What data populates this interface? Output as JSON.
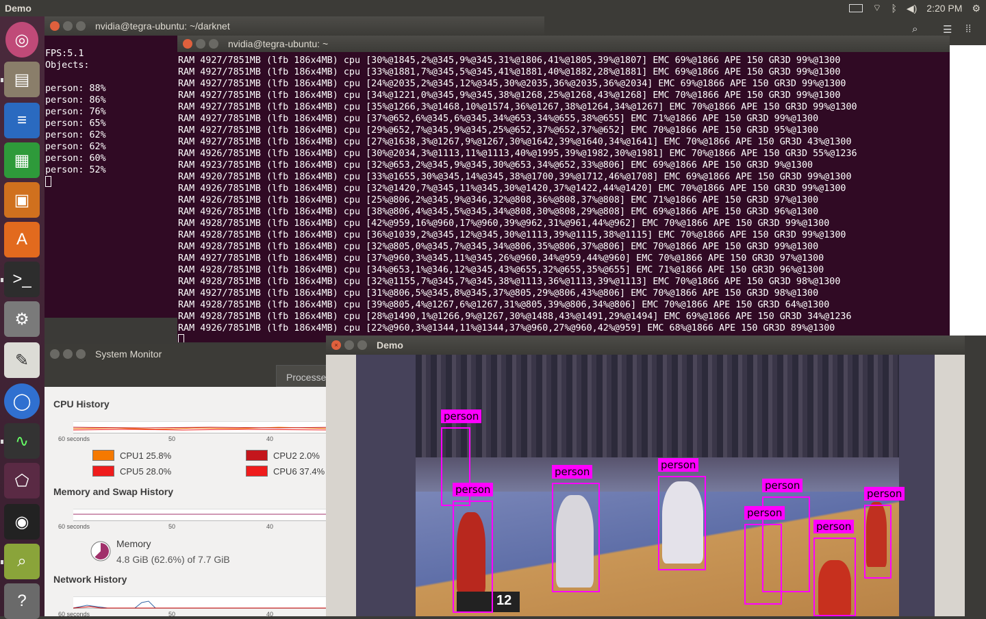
{
  "topbar": {
    "app_title": "Demo",
    "time": "2:20 PM",
    "icons": [
      "keyboard-icon",
      "wifi-icon",
      "bluetooth-icon",
      "volume-icon",
      "gear-icon"
    ]
  },
  "launcher": {
    "items": [
      "ubuntu-icon",
      "files-icon",
      "writer-icon",
      "calc-icon",
      "impress-icon",
      "software-center-icon",
      "terminal-icon",
      "settings-icon",
      "text-editor-icon",
      "chromium-icon",
      "system-monitor-icon",
      "tag-icon",
      "webcam-icon",
      "image-viewer-icon",
      "help-icon"
    ]
  },
  "term1": {
    "title": "nvidia@tegra-ubuntu: ~/darknet",
    "lines": [
      "FPS:5.1",
      "Objects:",
      "",
      "person: 88%",
      "person: 86%",
      "person: 76%",
      "person: 65%",
      "person: 62%",
      "person: 62%",
      "person: 60%",
      "person: 52%"
    ]
  },
  "term2": {
    "title": "nvidia@tegra-ubuntu: ~",
    "lines": [
      "RAM 4927/7851MB (lfb 186x4MB) cpu [30%@1845,2%@345,9%@345,31%@1806,41%@1805,39%@1807] EMC 69%@1866 APE 150 GR3D 99%@1300",
      "RAM 4927/7851MB (lfb 186x4MB) cpu [33%@1881,7%@345,5%@345,41%@1881,40%@1882,28%@1881] EMC 69%@1866 APE 150 GR3D 99%@1300",
      "RAM 4927/7851MB (lfb 186x4MB) cpu [24%@2035,2%@345,12%@345,30%@2035,36%@2035,36%@2034] EMC 69%@1866 APE 150 GR3D 99%@1300",
      "RAM 4927/7851MB (lfb 186x4MB) cpu [34%@1221,0%@345,9%@345,38%@1268,25%@1268,43%@1268] EMC 70%@1866 APE 150 GR3D 99%@1300",
      "RAM 4927/7851MB (lfb 186x4MB) cpu [35%@1266,3%@1468,10%@1574,36%@1267,38%@1264,34%@1267] EMC 70%@1866 APE 150 GR3D 99%@1300",
      "RAM 4927/7851MB (lfb 186x4MB) cpu [37%@652,6%@345,6%@345,34%@653,34%@655,38%@655] EMC 71%@1866 APE 150 GR3D 99%@1300",
      "RAM 4927/7851MB (lfb 186x4MB) cpu [29%@652,7%@345,9%@345,25%@652,37%@652,37%@652] EMC 70%@1866 APE 150 GR3D 95%@1300",
      "RAM 4927/7851MB (lfb 186x4MB) cpu [27%@1638,3%@1267,9%@1267,30%@1642,39%@1640,34%@1641] EMC 70%@1866 APE 150 GR3D 43%@1300",
      "RAM 4926/7851MB (lfb 186x4MB) cpu [30%@2034,3%@1113,11%@1113,40%@1995,39%@1982,30%@1981] EMC 70%@1866 APE 150 GR3D 55%@1236",
      "RAM 4923/7851MB (lfb 186x4MB) cpu [32%@653,2%@345,9%@345,30%@653,34%@652,33%@806] EMC 69%@1866 APE 150 GR3D 9%@1300",
      "RAM 4920/7851MB (lfb 186x4MB) cpu [33%@1655,30%@345,14%@345,38%@1700,39%@1712,46%@1708] EMC 69%@1866 APE 150 GR3D 99%@1300",
      "RAM 4926/7851MB (lfb 186x4MB) cpu [32%@1420,7%@345,11%@345,30%@1420,37%@1422,44%@1420] EMC 70%@1866 APE 150 GR3D 99%@1300",
      "RAM 4926/7851MB (lfb 186x4MB) cpu [25%@806,2%@345,9%@346,32%@808,36%@808,37%@808] EMC 71%@1866 APE 150 GR3D 97%@1300",
      "RAM 4926/7851MB (lfb 186x4MB) cpu [38%@806,4%@345,5%@345,34%@808,30%@808,29%@808] EMC 69%@1866 APE 150 GR3D 96%@1300",
      "RAM 4928/7851MB (lfb 186x4MB) cpu [42%@959,16%@960,17%@960,39%@962,31%@961,44%@962] EMC 70%@1866 APE 150 GR3D 99%@1300",
      "RAM 4928/7851MB (lfb 186x4MB) cpu [36%@1039,2%@345,12%@345,30%@1113,39%@1115,38%@1115] EMC 70%@1866 APE 150 GR3D 99%@1300",
      "RAM 4928/7851MB (lfb 186x4MB) cpu [32%@805,0%@345,7%@345,34%@806,35%@806,37%@806] EMC 70%@1866 APE 150 GR3D 99%@1300",
      "RAM 4927/7851MB (lfb 186x4MB) cpu [37%@960,3%@345,11%@345,26%@960,34%@959,44%@960] EMC 70%@1866 APE 150 GR3D 97%@1300",
      "RAM 4928/7851MB (lfb 186x4MB) cpu [34%@653,1%@346,12%@345,43%@655,32%@655,35%@655] EMC 71%@1866 APE 150 GR3D 96%@1300",
      "RAM 4928/7851MB (lfb 186x4MB) cpu [32%@1155,7%@345,7%@345,38%@1113,36%@1113,39%@1113] EMC 70%@1866 APE 150 GR3D 98%@1300",
      "RAM 4927/7851MB (lfb 186x4MB) cpu [31%@806,5%@345,8%@345,37%@805,29%@806,43%@806] EMC 70%@1866 APE 150 GR3D 98%@1300",
      "RAM 4928/7851MB (lfb 186x4MB) cpu [39%@805,4%@1267,6%@1267,31%@805,39%@806,34%@806] EMC 70%@1866 APE 150 GR3D 64%@1300",
      "RAM 4928/7851MB (lfb 186x4MB) cpu [28%@1490,1%@1266,9%@1267,30%@1488,43%@1491,29%@1494] EMC 69%@1866 APE 150 GR3D 34%@1236",
      "RAM 4926/7851MB (lfb 186x4MB) cpu [22%@960,3%@1344,11%@1344,37%@960,27%@960,42%@959] EMC 68%@1866 APE 150 GR3D 89%@1300"
    ]
  },
  "sysmon": {
    "title": "System Monitor",
    "tab_processes": "Processe",
    "cpu_title": "CPU History",
    "mem_title": "Memory and Swap History",
    "net_title": "Network History",
    "tick_60": "60 seconds",
    "tick_50": "50",
    "tick_40": "40",
    "cpu1": "CPU1  25.8%",
    "cpu2": "CPU2  2.0%",
    "cpu5": "CPU5  28.0%",
    "cpu6": "CPU6  37.4%",
    "mem_label": "Memory",
    "mem_value": "4.8 GiB (62.6%) of 7.7 GiB",
    "mem_fraction": 0.626,
    "colors": {
      "cpu1": "#f57900",
      "cpu2": "#c4161c",
      "cpu5": "#ef1c1c",
      "cpu6": "#ef1c1c"
    }
  },
  "demo": {
    "title": "Demo",
    "label": "person",
    "score": "12"
  }
}
